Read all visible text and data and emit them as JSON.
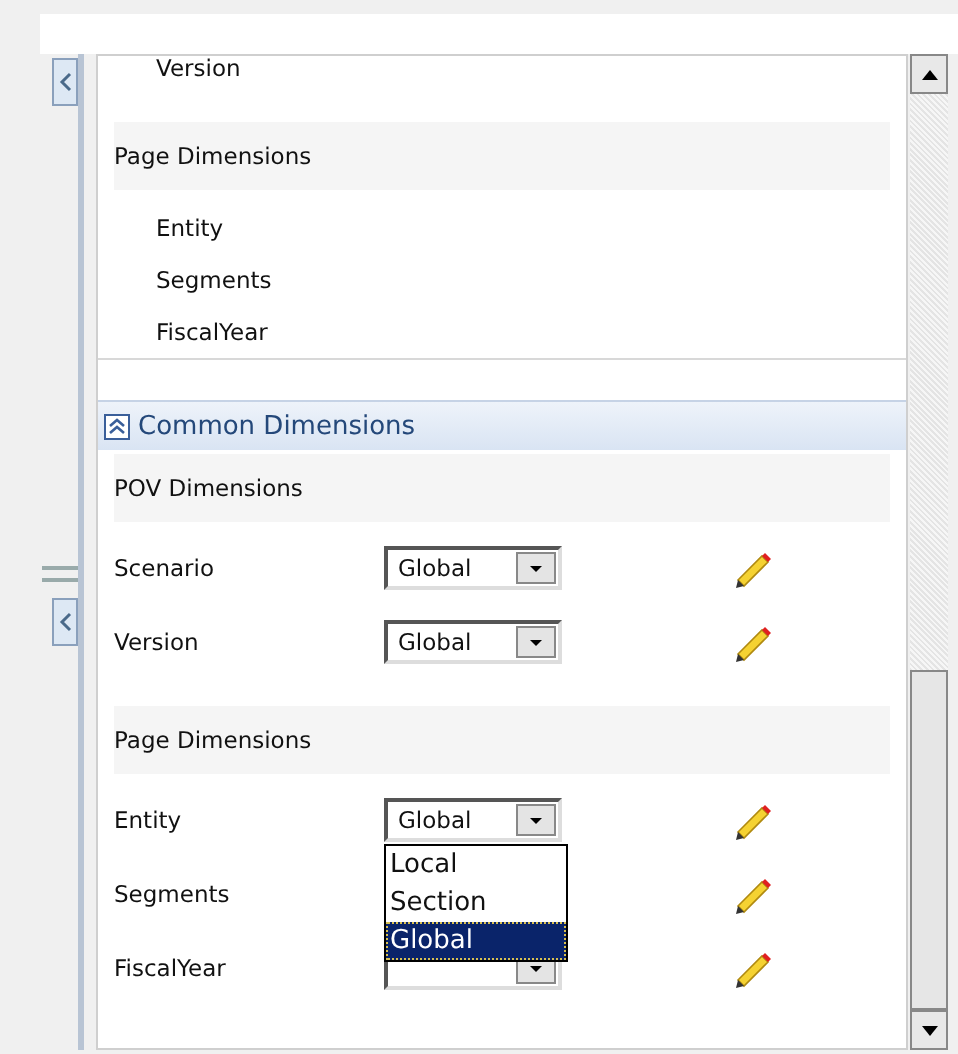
{
  "top_list": {
    "cut_item": "Version",
    "section": "Page Dimensions",
    "items": [
      "Entity",
      "Segments",
      "FiscalYear"
    ]
  },
  "panel": {
    "title": "Common Dimensions",
    "expanded": true,
    "groups": [
      {
        "title": "POV Dimensions",
        "rows": [
          {
            "label": "Scenario",
            "kind": "select",
            "value": "Global"
          },
          {
            "label": "Version",
            "kind": "select",
            "value": "Global"
          }
        ]
      },
      {
        "title": "Page Dimensions",
        "rows": [
          {
            "label": "Entity",
            "kind": "select",
            "value": "Global",
            "open": true,
            "options": [
              {
                "label": "Local",
                "selected": false
              },
              {
                "label": "Section",
                "selected": false
              },
              {
                "label": "Global",
                "selected": true
              }
            ]
          },
          {
            "label": "Segments",
            "kind": "hidden"
          },
          {
            "label": "FiscalYear",
            "kind": "select"
          }
        ]
      }
    ]
  }
}
